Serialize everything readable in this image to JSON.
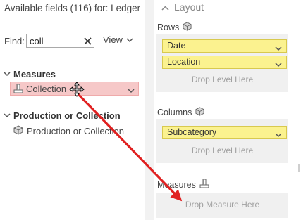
{
  "fields_panel": {
    "title": "Available fields (116) for: Ledger",
    "find": {
      "label": "Find:",
      "value": "coll"
    },
    "view_label": "View",
    "groups": [
      {
        "label": "Measures",
        "items": [
          {
            "label": "Collection",
            "state": "dragging"
          }
        ]
      },
      {
        "label": "Production or Collection",
        "items": [
          {
            "label": "Production or Collection"
          }
        ]
      }
    ]
  },
  "layout_panel": {
    "title": "Layout",
    "rows": {
      "label": "Rows",
      "pills": [
        "Date",
        "Location"
      ],
      "drop_text": "Drop Level Here"
    },
    "columns": {
      "label": "Columns",
      "pills": [
        "Subcategory"
      ],
      "drop_text": "Drop Level Here"
    },
    "measures": {
      "label": "Measures",
      "drop_text": "Drop Measure Here"
    }
  },
  "colors": {
    "pill_fill": "#fbf28f",
    "dragging_fill": "#f6c8c8",
    "arrow": "#e02020"
  },
  "icons": [
    "close-icon",
    "chevron-down-icon",
    "measure-ruler-icon",
    "dimension-cube-icon",
    "move-cursor-icon",
    "chevron-up-icon"
  ]
}
